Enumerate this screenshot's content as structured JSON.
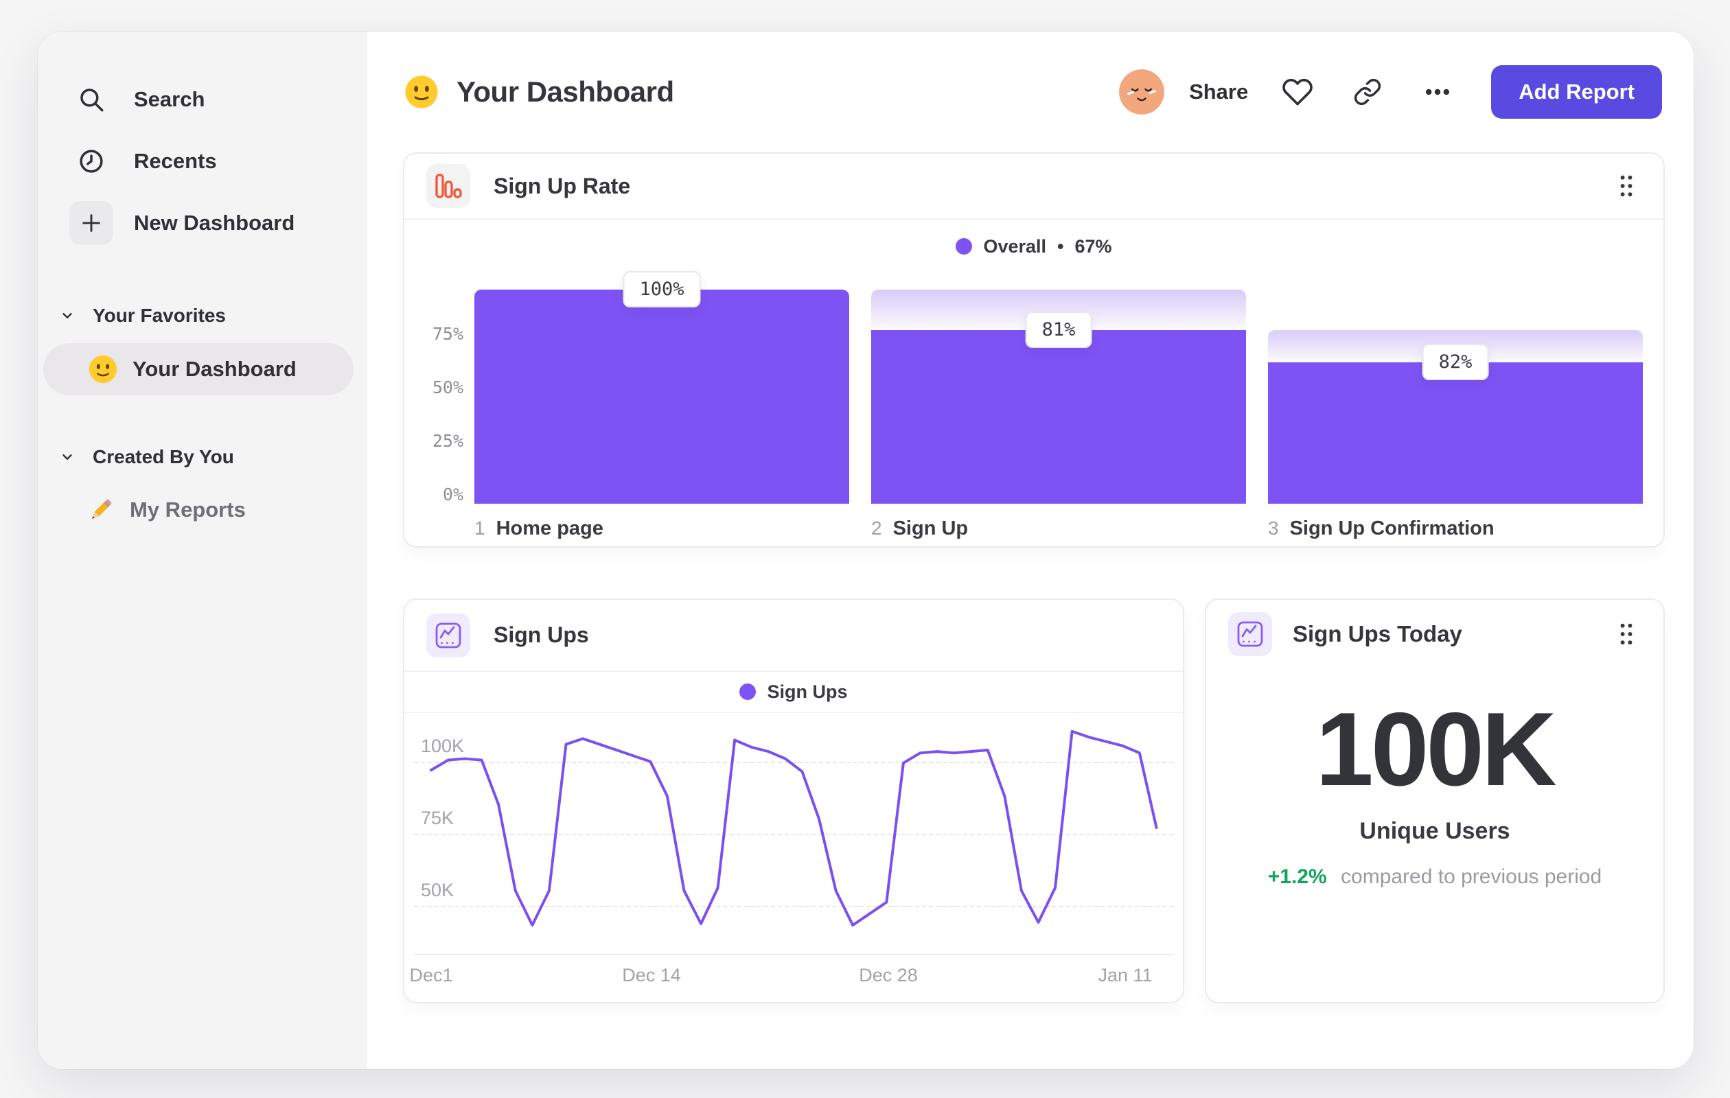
{
  "sidebar": {
    "items": [
      {
        "label": "Search",
        "icon": "search-icon"
      },
      {
        "label": "Recents",
        "icon": "clock-icon"
      },
      {
        "label": "New Dashboard",
        "icon": "plus-icon"
      }
    ],
    "sections": [
      {
        "label": "Your Favorites",
        "items": [
          {
            "label": "Your Dashboard",
            "icon": "smiley-emoji",
            "active": true
          }
        ]
      },
      {
        "label": "Created By You",
        "items": [
          {
            "label": "My Reports",
            "icon": "pencil-emoji",
            "active": false
          }
        ]
      }
    ]
  },
  "header": {
    "title": "Your Dashboard",
    "title_icon": "smiley-emoji",
    "share_label": "Share",
    "add_report_label": "Add Report"
  },
  "cards": {
    "funnel": {
      "title": "Sign Up Rate",
      "legend_label": "Overall",
      "legend_sep": "•",
      "legend_value": "67%"
    },
    "line": {
      "title": "Sign Ups",
      "legend_label": "Sign Ups"
    },
    "kpi": {
      "title": "Sign Ups Today",
      "value": "100K",
      "unit_label": "Unique Users",
      "delta": "+1.2%",
      "delta_note": "compared to previous period"
    }
  },
  "colors": {
    "accent": "#7e53f4",
    "line": "#7b50f0",
    "button": "#594ae2",
    "orange": "#f05b3f",
    "green": "#12a45c"
  },
  "chart_data": [
    {
      "type": "bar",
      "subtype": "funnel",
      "title": "Sign Up Rate",
      "legend": {
        "label": "Overall",
        "value": "67%"
      },
      "categories": [
        "Home page",
        "Sign Up",
        "Sign Up Confirmation"
      ],
      "step_numbers": [
        "1",
        "2",
        "3"
      ],
      "step_conversion_labels": [
        "100%",
        "81%",
        "82%"
      ],
      "overall_pct": [
        100,
        81,
        66
      ],
      "prev_overall_pct": [
        null,
        100,
        81
      ],
      "y_ticks": [
        75,
        50,
        25,
        0
      ],
      "y_tick_labels": [
        "75%",
        "50%",
        "25%",
        "0%"
      ],
      "ylim": [
        0,
        100
      ],
      "grid": "off",
      "legend_position": "top-center"
    },
    {
      "type": "line",
      "title": "Sign Ups",
      "series": [
        {
          "name": "Sign Ups",
          "values": [
            97,
            100.5,
            101,
            100.5,
            85,
            55,
            43,
            55,
            106,
            108,
            106,
            104,
            102,
            100,
            88,
            55,
            43.5,
            56,
            107.5,
            105,
            103.5,
            101,
            96.5,
            80,
            55,
            43,
            47,
            51,
            99.5,
            103,
            103.5,
            103,
            103.5,
            104,
            88,
            55,
            44,
            56,
            110.5,
            108.5,
            107,
            105.5,
            103,
            77
          ]
        }
      ],
      "values_unit": "K users (thousands)",
      "x_unit": "day",
      "x_tick_positions": [
        0,
        13,
        27,
        41
      ],
      "x_tick_labels": [
        "Dec1",
        "Dec 14",
        "Dec 28",
        "Jan 11"
      ],
      "y_ticks": [
        100,
        75,
        50
      ],
      "y_tick_labels": [
        "100K",
        "75K",
        "50K"
      ],
      "ylim": [
        33,
        115
      ],
      "grid": "dashed-horizontal",
      "legend_position": "top-center"
    },
    {
      "type": "metric",
      "title": "Sign Ups Today",
      "value": "100K",
      "label": "Unique Users",
      "delta": "+1.2%",
      "delta_note": "compared to previous period"
    }
  ]
}
